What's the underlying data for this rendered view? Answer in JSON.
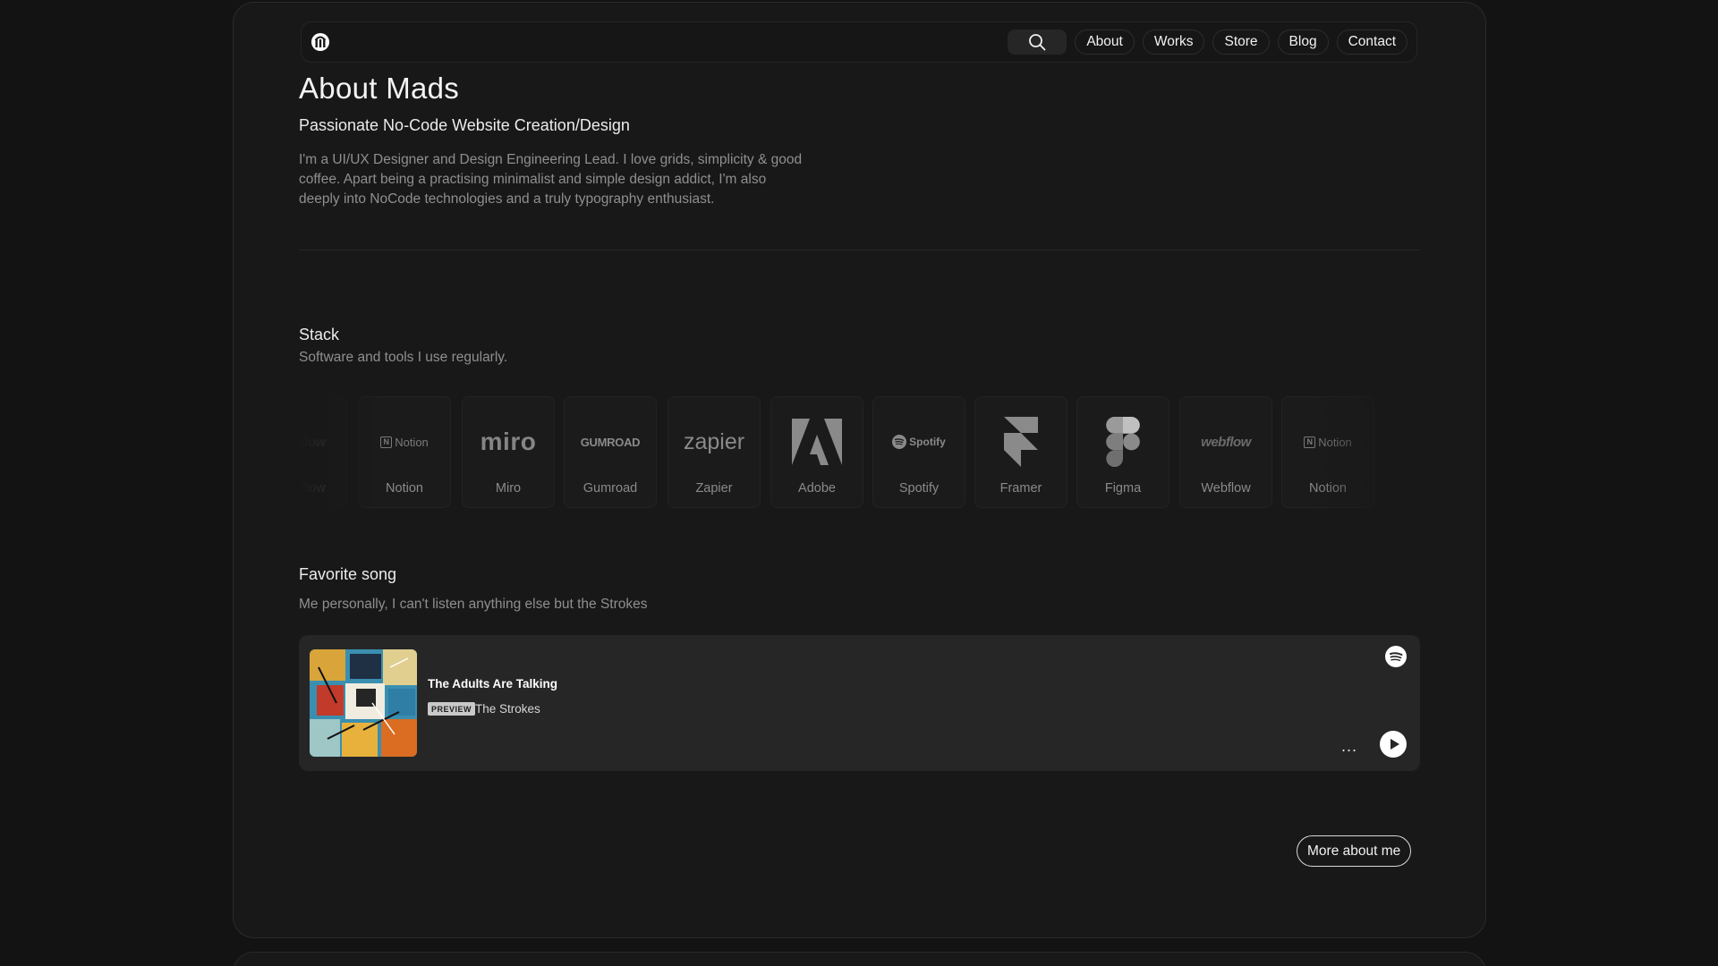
{
  "nav": {
    "logo_icon": "mads-logo-icon",
    "search_icon": "search-icon",
    "links": [
      "About",
      "Works",
      "Store",
      "Blog",
      "Contact"
    ]
  },
  "header": {
    "title": "About Mads",
    "subtitle": "Passionate No-Code Website Creation/Design",
    "bio": "I'm a UI/UX Designer and Design Engineering Lead. I love grids, simplicity & good coffee. Apart being a practising minimalist and simple design addict, I'm also deeply into NoCode technologies and a truly typography enthusiast."
  },
  "stack": {
    "heading": "Stack",
    "description": "Software and tools I use regularly.",
    "items": [
      {
        "label": "Webflow",
        "logo_text": "webflow"
      },
      {
        "label": "Notion",
        "logo_text": "Notion"
      },
      {
        "label": "Miro",
        "logo_text": "miro"
      },
      {
        "label": "Gumroad",
        "logo_text": "GUMROAD"
      },
      {
        "label": "Zapier",
        "logo_text": "zapier"
      },
      {
        "label": "Adobe",
        "logo_text": ""
      },
      {
        "label": "Spotify",
        "logo_text": "Spotify"
      },
      {
        "label": "Framer",
        "logo_text": ""
      },
      {
        "label": "Figma",
        "logo_text": ""
      },
      {
        "label": "Webflow",
        "logo_text": "webflow"
      },
      {
        "label": "Notion",
        "logo_text": "Notion"
      }
    ]
  },
  "song": {
    "heading": "Favorite song",
    "description": "Me personally, I can't listen anything else but the Strokes",
    "title": "The Adults Are Talking",
    "badge": "PREVIEW",
    "artist": "The Strokes",
    "more_label": "...",
    "spotify_icon": "spotify-icon",
    "play_icon": "play-icon"
  },
  "more_button": "More about me",
  "colors": {
    "background": "#131313",
    "panel": "#181818",
    "player": "#262626",
    "text_muted": "#8f8f8f"
  }
}
